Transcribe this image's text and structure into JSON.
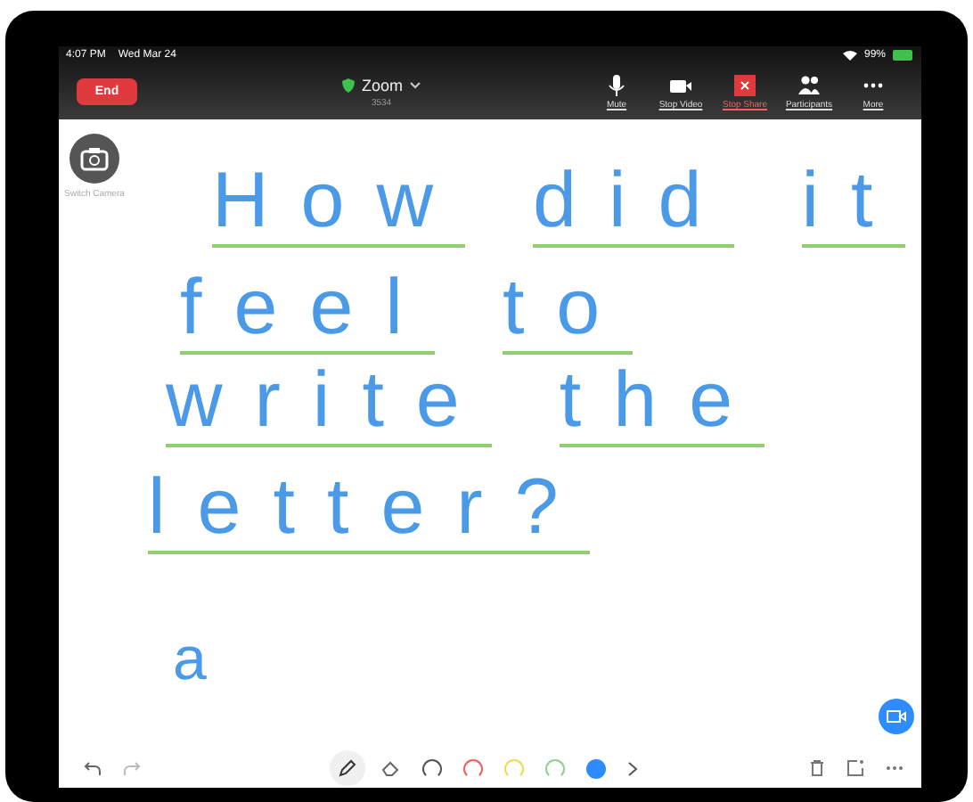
{
  "status_bar": {
    "time": "4:07 PM",
    "date": "Wed Mar 24",
    "battery": "99%"
  },
  "meeting_bar": {
    "end_label": "End",
    "title": "Zoom",
    "meeting_id": "3534",
    "controls": [
      {
        "kind": "mic",
        "label": "Mute",
        "alert": false
      },
      {
        "kind": "video",
        "label": "Stop Video",
        "alert": false
      },
      {
        "kind": "share",
        "label": "Stop Share",
        "alert": true
      },
      {
        "kind": "people",
        "label": "Participants",
        "alert": false
      },
      {
        "kind": "more",
        "label": "More",
        "alert": false
      }
    ]
  },
  "switch_camera": {
    "label": "Switch Camera"
  },
  "whiteboard": {
    "lines": [
      {
        "words": [
          "How",
          "did",
          "it"
        ],
        "underlined": true
      },
      {
        "words": [
          "feel",
          "to"
        ],
        "underlined": true
      },
      {
        "words": [
          "write",
          "the"
        ],
        "underlined": true
      },
      {
        "words": [
          "letter?"
        ],
        "underlined": true
      },
      {
        "words": [
          "a"
        ],
        "underlined": false
      }
    ]
  },
  "drawing_toolbar": {
    "tools": [
      {
        "kind": "pen",
        "selected": true
      },
      {
        "kind": "eraser",
        "selected": false
      }
    ],
    "colors": [
      {
        "color": "#555555",
        "selected": false
      },
      {
        "color": "#f25c5c",
        "selected": false
      },
      {
        "color": "#f2d94e",
        "selected": false
      },
      {
        "color": "#8fd18f",
        "selected": false
      },
      {
        "color": "#2d8cff",
        "selected": true
      }
    ]
  }
}
